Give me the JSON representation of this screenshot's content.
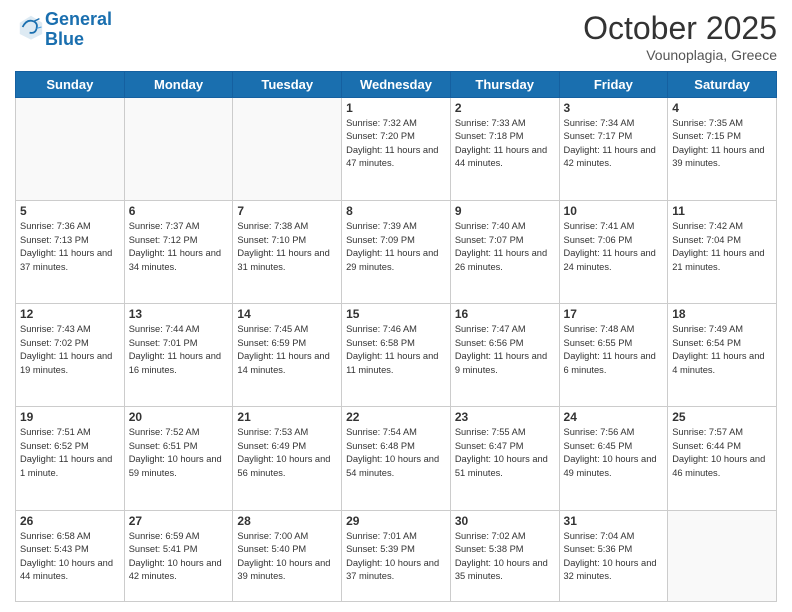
{
  "header": {
    "logo_line1": "General",
    "logo_line2": "Blue",
    "month": "October 2025",
    "location": "Vounoplagia, Greece"
  },
  "weekdays": [
    "Sunday",
    "Monday",
    "Tuesday",
    "Wednesday",
    "Thursday",
    "Friday",
    "Saturday"
  ],
  "weeks": [
    [
      {
        "day": "",
        "info": ""
      },
      {
        "day": "",
        "info": ""
      },
      {
        "day": "",
        "info": ""
      },
      {
        "day": "1",
        "info": "Sunrise: 7:32 AM\nSunset: 7:20 PM\nDaylight: 11 hours\nand 47 minutes."
      },
      {
        "day": "2",
        "info": "Sunrise: 7:33 AM\nSunset: 7:18 PM\nDaylight: 11 hours\nand 44 minutes."
      },
      {
        "day": "3",
        "info": "Sunrise: 7:34 AM\nSunset: 7:17 PM\nDaylight: 11 hours\nand 42 minutes."
      },
      {
        "day": "4",
        "info": "Sunrise: 7:35 AM\nSunset: 7:15 PM\nDaylight: 11 hours\nand 39 minutes."
      }
    ],
    [
      {
        "day": "5",
        "info": "Sunrise: 7:36 AM\nSunset: 7:13 PM\nDaylight: 11 hours\nand 37 minutes."
      },
      {
        "day": "6",
        "info": "Sunrise: 7:37 AM\nSunset: 7:12 PM\nDaylight: 11 hours\nand 34 minutes."
      },
      {
        "day": "7",
        "info": "Sunrise: 7:38 AM\nSunset: 7:10 PM\nDaylight: 11 hours\nand 31 minutes."
      },
      {
        "day": "8",
        "info": "Sunrise: 7:39 AM\nSunset: 7:09 PM\nDaylight: 11 hours\nand 29 minutes."
      },
      {
        "day": "9",
        "info": "Sunrise: 7:40 AM\nSunset: 7:07 PM\nDaylight: 11 hours\nand 26 minutes."
      },
      {
        "day": "10",
        "info": "Sunrise: 7:41 AM\nSunset: 7:06 PM\nDaylight: 11 hours\nand 24 minutes."
      },
      {
        "day": "11",
        "info": "Sunrise: 7:42 AM\nSunset: 7:04 PM\nDaylight: 11 hours\nand 21 minutes."
      }
    ],
    [
      {
        "day": "12",
        "info": "Sunrise: 7:43 AM\nSunset: 7:02 PM\nDaylight: 11 hours\nand 19 minutes."
      },
      {
        "day": "13",
        "info": "Sunrise: 7:44 AM\nSunset: 7:01 PM\nDaylight: 11 hours\nand 16 minutes."
      },
      {
        "day": "14",
        "info": "Sunrise: 7:45 AM\nSunset: 6:59 PM\nDaylight: 11 hours\nand 14 minutes."
      },
      {
        "day": "15",
        "info": "Sunrise: 7:46 AM\nSunset: 6:58 PM\nDaylight: 11 hours\nand 11 minutes."
      },
      {
        "day": "16",
        "info": "Sunrise: 7:47 AM\nSunset: 6:56 PM\nDaylight: 11 hours\nand 9 minutes."
      },
      {
        "day": "17",
        "info": "Sunrise: 7:48 AM\nSunset: 6:55 PM\nDaylight: 11 hours\nand 6 minutes."
      },
      {
        "day": "18",
        "info": "Sunrise: 7:49 AM\nSunset: 6:54 PM\nDaylight: 11 hours\nand 4 minutes."
      }
    ],
    [
      {
        "day": "19",
        "info": "Sunrise: 7:51 AM\nSunset: 6:52 PM\nDaylight: 11 hours\nand 1 minute."
      },
      {
        "day": "20",
        "info": "Sunrise: 7:52 AM\nSunset: 6:51 PM\nDaylight: 10 hours\nand 59 minutes."
      },
      {
        "day": "21",
        "info": "Sunrise: 7:53 AM\nSunset: 6:49 PM\nDaylight: 10 hours\nand 56 minutes."
      },
      {
        "day": "22",
        "info": "Sunrise: 7:54 AM\nSunset: 6:48 PM\nDaylight: 10 hours\nand 54 minutes."
      },
      {
        "day": "23",
        "info": "Sunrise: 7:55 AM\nSunset: 6:47 PM\nDaylight: 10 hours\nand 51 minutes."
      },
      {
        "day": "24",
        "info": "Sunrise: 7:56 AM\nSunset: 6:45 PM\nDaylight: 10 hours\nand 49 minutes."
      },
      {
        "day": "25",
        "info": "Sunrise: 7:57 AM\nSunset: 6:44 PM\nDaylight: 10 hours\nand 46 minutes."
      }
    ],
    [
      {
        "day": "26",
        "info": "Sunrise: 6:58 AM\nSunset: 5:43 PM\nDaylight: 10 hours\nand 44 minutes."
      },
      {
        "day": "27",
        "info": "Sunrise: 6:59 AM\nSunset: 5:41 PM\nDaylight: 10 hours\nand 42 minutes."
      },
      {
        "day": "28",
        "info": "Sunrise: 7:00 AM\nSunset: 5:40 PM\nDaylight: 10 hours\nand 39 minutes."
      },
      {
        "day": "29",
        "info": "Sunrise: 7:01 AM\nSunset: 5:39 PM\nDaylight: 10 hours\nand 37 minutes."
      },
      {
        "day": "30",
        "info": "Sunrise: 7:02 AM\nSunset: 5:38 PM\nDaylight: 10 hours\nand 35 minutes."
      },
      {
        "day": "31",
        "info": "Sunrise: 7:04 AM\nSunset: 5:36 PM\nDaylight: 10 hours\nand 32 minutes."
      },
      {
        "day": "",
        "info": ""
      }
    ]
  ]
}
